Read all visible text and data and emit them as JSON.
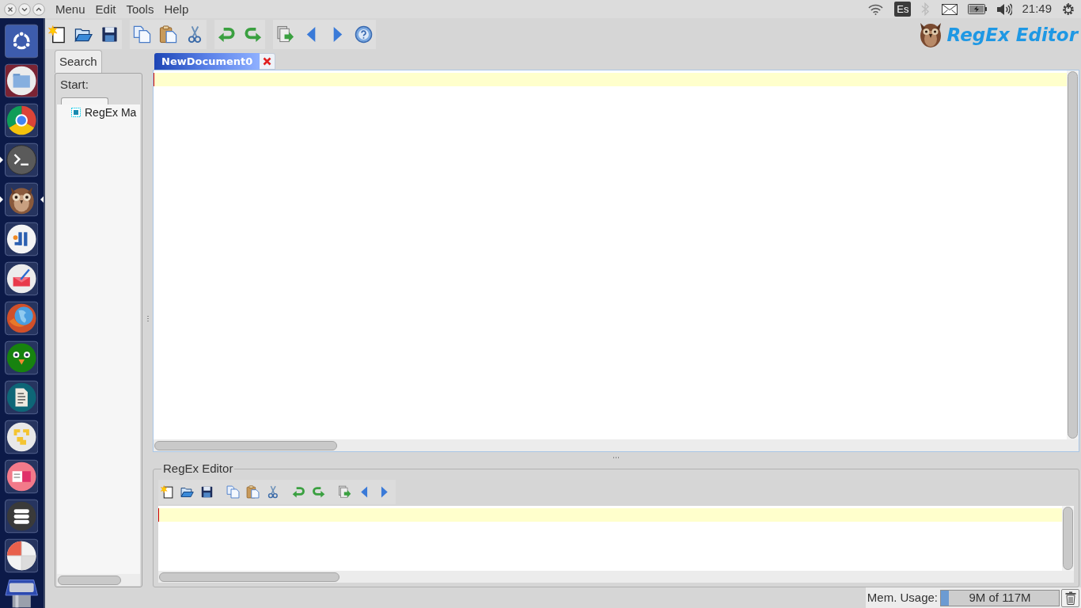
{
  "top_panel": {
    "menu": [
      {
        "label": "Menu"
      },
      {
        "label": "Edit"
      },
      {
        "label": "Tools"
      },
      {
        "label": "Help"
      }
    ],
    "keyboard_layout": "Es",
    "clock": "21:49"
  },
  "launcher": {
    "items": [
      {
        "kind": "dash",
        "running": false,
        "focused": false
      },
      {
        "kind": "files",
        "running": false,
        "focused": false
      },
      {
        "kind": "browser",
        "running": false,
        "focused": false
      },
      {
        "kind": "terminal",
        "running": true,
        "focused": false
      },
      {
        "kind": "owl",
        "running": true,
        "focused": true
      },
      {
        "kind": "ide",
        "running": false,
        "focused": false
      },
      {
        "kind": "writer",
        "running": false,
        "focused": false
      },
      {
        "kind": "web",
        "running": false,
        "focused": false
      },
      {
        "kind": "bird",
        "running": false,
        "focused": false
      },
      {
        "kind": "document",
        "running": false,
        "focused": false
      },
      {
        "kind": "puzzle",
        "running": false,
        "focused": false
      },
      {
        "kind": "slides",
        "running": false,
        "focused": false
      },
      {
        "kind": "database",
        "running": false,
        "focused": false
      },
      {
        "kind": "chart",
        "running": false,
        "focused": false
      },
      {
        "kind": "drive",
        "running": false,
        "focused": false
      }
    ]
  },
  "logo": {
    "text": "RegEx Editor"
  },
  "side_panel": {
    "tabs": [
      {
        "label": "Search",
        "selected": true
      }
    ],
    "start_label": "Start:",
    "tree": [
      {
        "label": "RegEx Ma"
      }
    ]
  },
  "editor": {
    "tabs": [
      {
        "label": "NewDocument0",
        "selected": true
      }
    ]
  },
  "regex_panel": {
    "title": "RegEx Editor"
  },
  "status_bar": {
    "memory_label": "Mem. Usage:",
    "memory": {
      "level": 0.07,
      "reading": "9M of 117M"
    }
  }
}
